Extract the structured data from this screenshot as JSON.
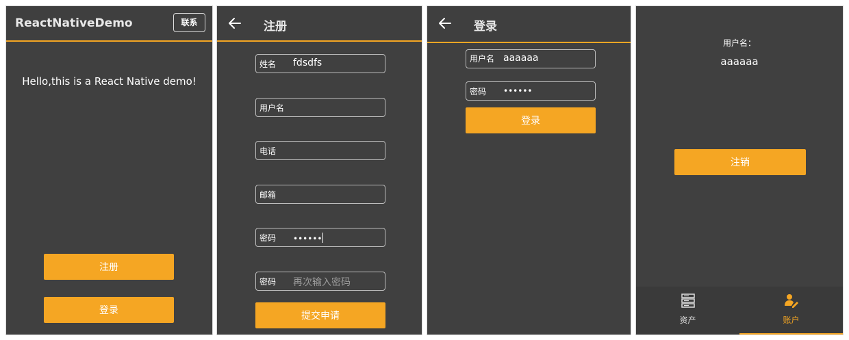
{
  "colors": {
    "accent": "#f5a623",
    "panel_bg": "#404040",
    "border": "#bdbdbd"
  },
  "home": {
    "title": "ReactNativeDemo",
    "contact_label": "联系",
    "hello_text": "Hello,this is a React Native demo!",
    "register_label": "注册",
    "login_label": "登录"
  },
  "register": {
    "title": "注册",
    "fields": [
      {
        "label": "姓名",
        "value": "fdsdfs",
        "placeholder": ""
      },
      {
        "label": "用户名",
        "value": "",
        "placeholder": ""
      },
      {
        "label": "电话",
        "value": "",
        "placeholder": ""
      },
      {
        "label": "邮箱",
        "value": "",
        "placeholder": ""
      },
      {
        "label": "密码",
        "value": "••••••",
        "placeholder": ""
      },
      {
        "label": "密码",
        "value": "",
        "placeholder": "再次输入密码"
      }
    ],
    "submit_label": "提交申请"
  },
  "login": {
    "title": "登录",
    "fields": [
      {
        "label": "用户名",
        "value": "aaaaaa"
      },
      {
        "label": "密码",
        "value": "••••••"
      }
    ],
    "submit_label": "登录"
  },
  "account": {
    "username_label": "用户名：",
    "username_value": "aaaaaa",
    "logout_label": "注销",
    "tabs": [
      {
        "label": "资产",
        "icon": "server-icon",
        "active": false
      },
      {
        "label": "账户",
        "icon": "user-edit-icon",
        "active": true
      }
    ]
  }
}
